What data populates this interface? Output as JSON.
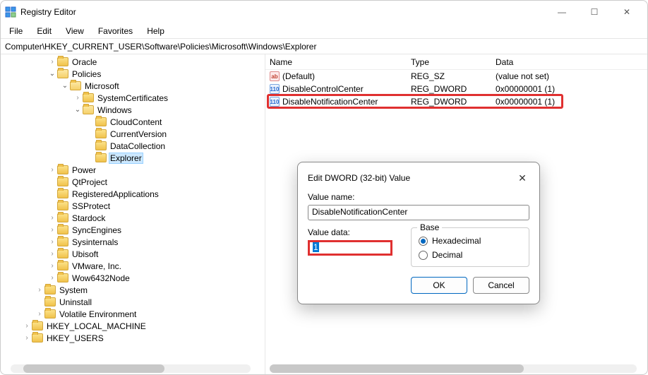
{
  "window": {
    "title": "Registry Editor",
    "controls": {
      "min": "—",
      "max": "☐",
      "close": "✕"
    }
  },
  "menu": {
    "file": "File",
    "edit": "Edit",
    "view": "View",
    "favorites": "Favorites",
    "help": "Help"
  },
  "address": "Computer\\HKEY_CURRENT_USER\\Software\\Policies\\Microsoft\\Windows\\Explorer",
  "tree": {
    "oracle": "Oracle",
    "policies": "Policies",
    "microsoft": "Microsoft",
    "systemCertificates": "SystemCertificates",
    "windows": "Windows",
    "cloudContent": "CloudContent",
    "currentVersion": "CurrentVersion",
    "dataCollection": "DataCollection",
    "explorer": "Explorer",
    "power": "Power",
    "qtProject": "QtProject",
    "registeredApplications": "RegisteredApplications",
    "ssProtect": "SSProtect",
    "stardock": "Stardock",
    "syncEngines": "SyncEngines",
    "sysinternals": "Sysinternals",
    "ubisoft": "Ubisoft",
    "vmware": "VMware, Inc.",
    "wow64": "Wow6432Node",
    "system": "System",
    "uninstall": "Uninstall",
    "volatile": "Volatile Environment",
    "hklm": "HKEY_LOCAL_MACHINE",
    "hku": "HKEY_USERS"
  },
  "columns": {
    "name": "Name",
    "type": "Type",
    "data": "Data"
  },
  "values": {
    "default": {
      "name": "(Default)",
      "type": "REG_SZ",
      "data": "(value not set)"
    },
    "disableControlCenter": {
      "name": "DisableControlCenter",
      "type": "REG_DWORD",
      "data": "0x00000001 (1)"
    },
    "disableNotificationCenter": {
      "name": "DisableNotificationCenter",
      "type": "REG_DWORD",
      "data": "0x00000001 (1)"
    }
  },
  "dialog": {
    "title": "Edit DWORD (32-bit) Value",
    "valueNameLabel": "Value name:",
    "valueName": "DisableNotificationCenter",
    "valueDataLabel": "Value data:",
    "valueData": "1",
    "baseLabel": "Base",
    "hex": "Hexadecimal",
    "dec": "Decimal",
    "ok": "OK",
    "cancel": "Cancel"
  },
  "icons": {
    "sz": "ab",
    "dword": "110"
  }
}
